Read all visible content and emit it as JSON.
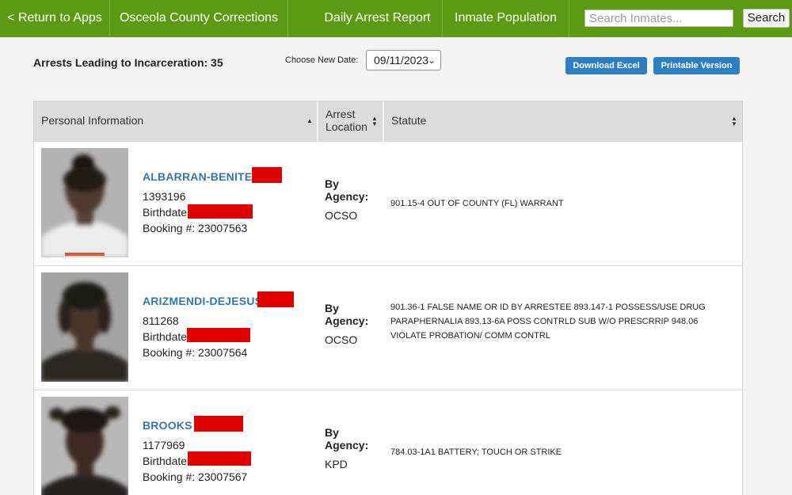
{
  "nav": {
    "back_label": "< Return to Apps",
    "title": "Osceola County Corrections",
    "daily_report": "Daily Arrest Report",
    "population": "Inmate Population",
    "search_placeholder": "Search Inmates...",
    "search_button": "Search"
  },
  "toolbar": {
    "arrest_count": "Arrests Leading to Incarceration: 35",
    "date_label": "Choose New Date:",
    "selected_date": "09/11/2023",
    "download_label": "Download Excel",
    "print_label": "Printable Version"
  },
  "table": {
    "headers": [
      "Personal Information",
      "Arrest Location",
      "Statute"
    ],
    "rows": [
      {
        "name": "ALBARRAN-BENITEZ",
        "id": "1393196",
        "birthdate_label": "Birthdate:",
        "booking_label": "Booking #: 23007563",
        "location_label": "By Agency:",
        "agency": "OCSO",
        "statute": "901.15-4 OUT OF COUNTY (FL) WARRANT"
      },
      {
        "name": "ARIZMENDI-DEJESUS ,",
        "id": "811268",
        "birthdate_label": "Birthdate:",
        "booking_label": "Booking #: 23007564",
        "location_label": "By Agency:",
        "agency": "OCSO",
        "statute": "901.36-1 FALSE NAME OR ID BY ARRESTEE 893.147-1 POSSESS/USE DRUG PARAPHERNALIA 893.13-6A POSS CONTRLD SUB W/O PRESCRRIP 948.06 VIOLATE PROBATION/ COMM CONTRL"
      },
      {
        "name": "BROOKS ,",
        "id": "1177969",
        "birthdate_label": "Birthdate:",
        "booking_label": "Booking #: 23007567",
        "location_label": "By Agency:",
        "agency": "KPD",
        "statute": "784.03-1A1 BATTERY; TOUCH OR STRIKE"
      }
    ]
  },
  "colors": {
    "nav_green": "#5c9a13",
    "button_blue": "#2d7fc1",
    "name_blue": "#3775a8",
    "redaction_red": "#e00000"
  }
}
